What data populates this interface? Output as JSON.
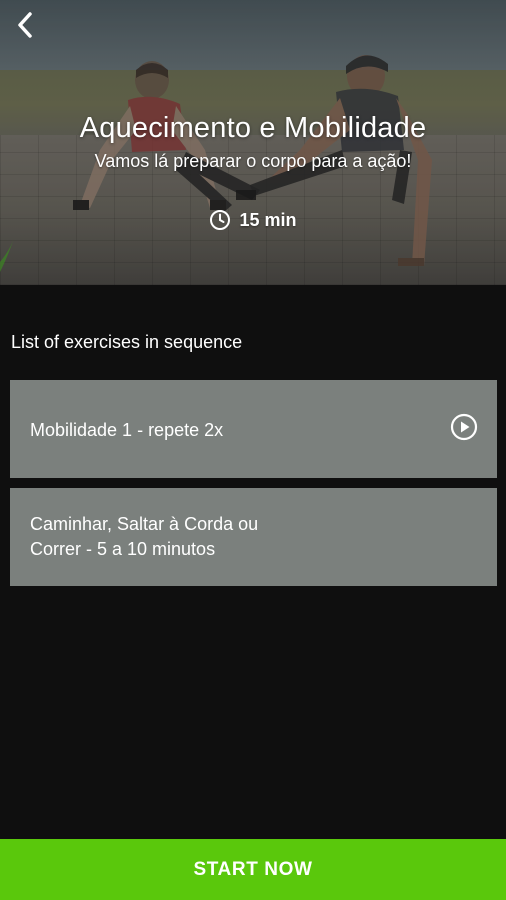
{
  "header": {
    "back_icon": "chevron-left-icon",
    "title": "Aquecimento e Mobilidade",
    "subtitle": "Vamos lá preparar o corpo para a ação!",
    "duration_icon": "clock-icon",
    "duration": "15 min"
  },
  "list": {
    "heading": "List of exercises in sequence",
    "items": [
      {
        "label_line1": "Mobilidade 1 - repete 2x",
        "label_line2": "",
        "icon": "play-circle-icon"
      },
      {
        "label_line1": "Caminhar, Saltar à Corda ou",
        "label_line2": "Correr - 5 a 10 minutos",
        "icon": ""
      }
    ]
  },
  "cta": {
    "label": "START NOW"
  },
  "colors": {
    "background": "#0f0f0f",
    "card": "#7b807d",
    "accent": "#5ac80c",
    "text": "#ffffff"
  }
}
